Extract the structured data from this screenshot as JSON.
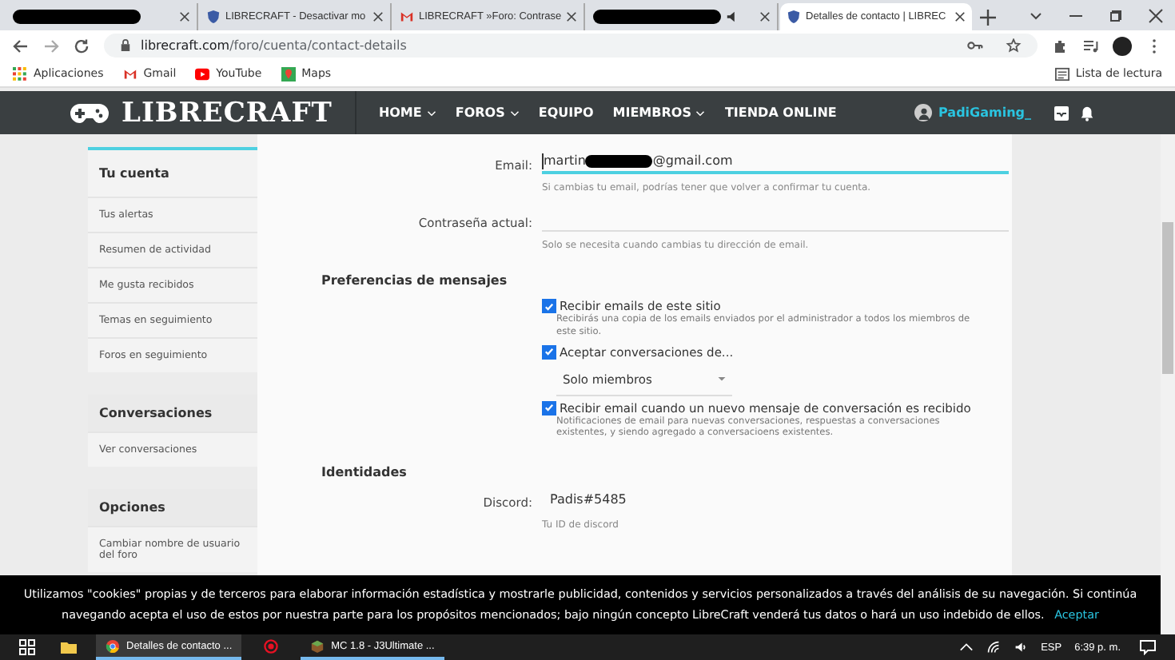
{
  "browser": {
    "tabs": [
      {
        "kind": "redacted",
        "selected": false
      },
      {
        "title": "LIBRECRAFT - Desactivar mo",
        "kind": "site",
        "selected": false
      },
      {
        "title": "LIBRECRAFT »Foro: Contrase",
        "kind": "mail",
        "selected": false
      },
      {
        "kind": "redacted-audio",
        "selected": false
      },
      {
        "title": "Detalles de contacto | LIBREC",
        "kind": "site",
        "selected": true
      }
    ],
    "url_host": "librecraft.com",
    "url_path": "/foro/cuenta/contact-details",
    "bookmarks": [
      {
        "label": "Aplicaciones",
        "kind": "apps"
      },
      {
        "label": "Gmail",
        "kind": "gmail"
      },
      {
        "label": "YouTube",
        "kind": "youtube"
      },
      {
        "label": "Maps",
        "kind": "maps"
      }
    ],
    "reading_list": "Lista de lectura"
  },
  "site": {
    "logo": "LIBRECRAFT",
    "nav": [
      {
        "label": "HOME",
        "dropdown": true
      },
      {
        "label": "FOROS",
        "dropdown": true
      },
      {
        "label": "EQUIPO",
        "dropdown": false
      },
      {
        "label": "MIEMBROS",
        "dropdown": true
      },
      {
        "label": "TIENDA ONLINE",
        "dropdown": false
      }
    ],
    "username": "PadiGaming_"
  },
  "sidebar": [
    {
      "title": "Tu cuenta",
      "items": [
        "Tus alertas",
        "Resumen de actividad",
        "Me gusta recibidos",
        "Temas en seguimiento",
        "Foros en seguimiento"
      ]
    },
    {
      "title": "Conversaciones",
      "items": [
        "Ver conversaciones"
      ]
    },
    {
      "title": "Opciones",
      "items": [
        "Cambiar nombre de usuario del foro"
      ]
    }
  ],
  "form": {
    "email": {
      "label": "Email:",
      "value_start": "martin",
      "value_end": "@gmail.com",
      "hint": "Si cambias tu email, podrías tener que volver a confirmar tu cuenta."
    },
    "password": {
      "label": "Contraseña actual:",
      "hint": "Solo se necesita cuando cambias tu dirección de email."
    },
    "preferences_title": "Preferencias de mensajes",
    "options": [
      {
        "kind": "checkbox",
        "label": "Recibir emails de este sitio",
        "checked": true,
        "hint": "Recibirás una copia de los emails enviados por el administrador a todos los miembros de este sitio."
      },
      {
        "kind": "checkbox",
        "label": "Aceptar conversaciones de...",
        "checked": true
      },
      {
        "kind": "select",
        "value": "Solo miembros"
      },
      {
        "kind": "checkbox",
        "label": "Recibir email cuando un nuevo mensaje de conversación es recibido",
        "checked": true,
        "hint": "Notificaciones de email para nuevas conversaciones, respuestas a conversaciones existentes, y siendo agregado a conversacioens existentes."
      }
    ],
    "identities_title": "Identidades",
    "discord": {
      "label": "Discord:",
      "value": "Padis#5485",
      "hint": "Tu ID de discord"
    }
  },
  "cookie_banner": {
    "text": "Utilizamos \"cookies\" propias y de terceros para elaborar información estadística y mostrarle publicidad, contenidos y servicios personalizados a través del análisis de su navegación. Si continúa navegando acepta el uso de estos por nuestra parte para los propósitos mencionados; bajo ningún concepto LibreCraft venderá tus datos o hará un uso indebido de ellos.",
    "accept": "Aceptar"
  },
  "taskbar": {
    "apps": [
      {
        "label": "Detalles de contacto ...",
        "kind": "chrome",
        "active": true
      },
      {
        "kind": "record",
        "active": false
      },
      {
        "label": "MC 1.8 - J3Ultimate ...",
        "kind": "minecraft",
        "active": false
      }
    ],
    "language": "ESP",
    "time": "6:39 p. m."
  }
}
